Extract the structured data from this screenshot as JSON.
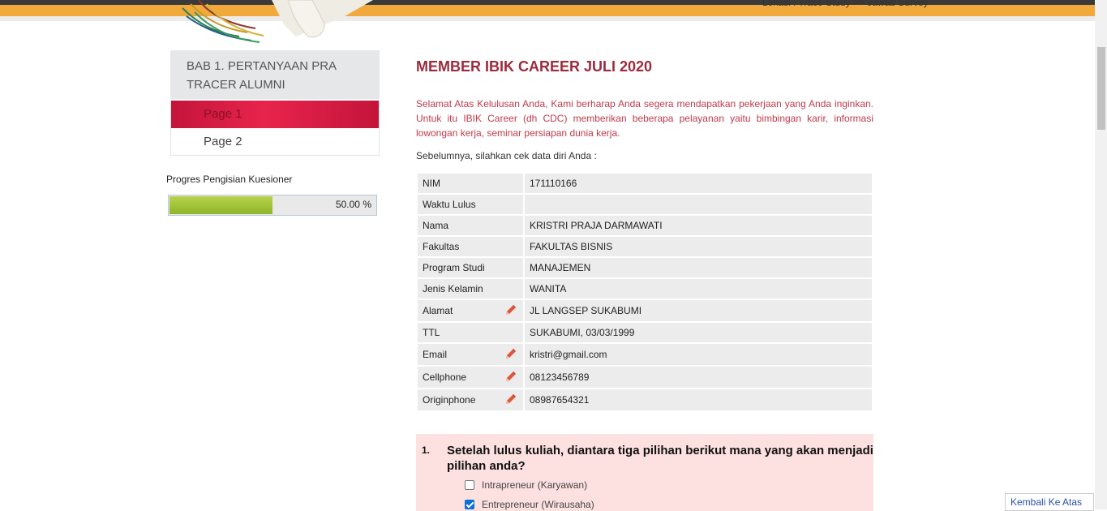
{
  "header": {
    "breadcrumb": "Lokasi : Trace Study >> Jawab Survey"
  },
  "sidebar": {
    "section_title": "BAB 1. PERTANYAAN PRA TRACER ALUMNI",
    "pages": [
      {
        "label": "Page 1",
        "active": true
      },
      {
        "label": "Page 2",
        "active": false
      }
    ],
    "progress_label": "Progres Pengisian Kuesioner",
    "progress_value": 0.5,
    "progress_text": "50.00 %"
  },
  "main": {
    "title": "MEMBER IBIK CAREER JULI 2020",
    "intro": "Selamat Atas Kelulusan Anda, Kami berharap Anda segera mendapatkan pekerjaan yang Anda inginkan. Untuk itu IBIK Career (dh CDC) memberikan beberapa pelayanan yaitu bimbingan karir, informasi lowongan kerja, seminar persiapan dunia kerja.",
    "check_text": "Sebelumnya, silahkan cek data diri Anda :",
    "rows": [
      {
        "label": "NIM",
        "value": "171110166"
      },
      {
        "label": "Waktu Lulus",
        "value": ""
      },
      {
        "label": "Nama",
        "value": "KRISTRI PRAJA DARMAWATI"
      },
      {
        "label": "Fakultas",
        "value": "FAKULTAS BISNIS"
      },
      {
        "label": "Program Studi",
        "value": "MANAJEMEN"
      },
      {
        "label": "Jenis Kelamin",
        "value": "WANITA"
      },
      {
        "label": "Alamat",
        "value": "JL LANGSEP SUKABUMI"
      },
      {
        "label": "TTL",
        "value": "SUKABUMI, 03/03/1999"
      },
      {
        "label": "Email",
        "value": "kristri@gmail.com"
      },
      {
        "label": "Cellphone",
        "value": "08123456789"
      },
      {
        "label": "Originphone",
        "value": "08987654321"
      }
    ],
    "question": {
      "number": "1.",
      "text": "Setelah lulus kuliah, diantara tiga pilihan berikut mana yang akan menjadi pilihan anda?",
      "options": [
        {
          "label": "Intrapreneur (Karyawan)",
          "checked": false
        },
        {
          "label": "Entrepreneur (Wirausaha)",
          "checked": true
        }
      ]
    }
  },
  "back_to_top": "Kembali Ke Atas",
  "colors": {
    "accent": "#f2a93b",
    "title": "#9c2a3d",
    "intro": "#c23a4a",
    "active_page": "#d81e44",
    "progress": "#a3c43a",
    "question_bg": "#fde0e0"
  },
  "icons": {
    "edit": "pencil-icon"
  }
}
